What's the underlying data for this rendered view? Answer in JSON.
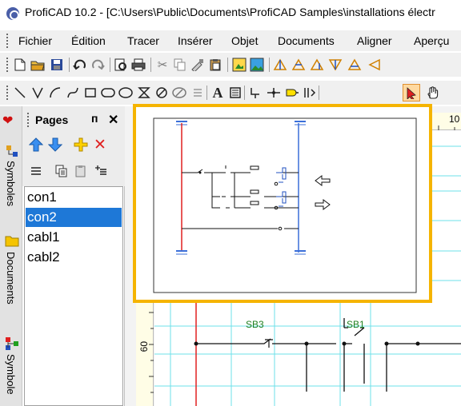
{
  "titlebar": {
    "title": "ProfiCAD 10.2 - [C:\\Users\\Public\\Documents\\ProfiCAD Samples\\installations électr"
  },
  "menubar": {
    "items": [
      "Fichier",
      "Édition",
      "Tracer",
      "Insérer",
      "Objet",
      "Documents",
      "Aligner",
      "Aperçu"
    ]
  },
  "toolbar1": {
    "icons": [
      "new-doc",
      "open-folder",
      "save",
      "undo",
      "redo",
      "print-preview",
      "print",
      "cut",
      "copy",
      "paste-brush",
      "paste",
      "image-tree",
      "image",
      "align-left",
      "align-center-h",
      "align-right",
      "align-top",
      "align-center-v",
      "align-bottom"
    ]
  },
  "toolbar2": {
    "icons": [
      "line",
      "polyline",
      "arc",
      "bezier",
      "rectangle",
      "rounded-rect",
      "ellipse",
      "hourglass",
      "no-entry",
      "eraser-shape",
      "lines",
      "text",
      "text-box",
      "wire",
      "junction",
      "terminal",
      "wire-bundle",
      "select-arrow",
      "pan-hand"
    ]
  },
  "leftstrip": {
    "tabs": [
      "Symboles",
      "Documents",
      "Symbole"
    ]
  },
  "pages": {
    "title": "Pages",
    "pin_glyph": "ᴨ",
    "close_glyph": "✕",
    "items": [
      "con1",
      "con2",
      "cabl1",
      "cabl2"
    ],
    "selected_index": 1
  },
  "ruler": {
    "top_label": "10",
    "left_label": "60"
  },
  "schematic": {
    "components": [
      "SB3",
      "SB1"
    ]
  },
  "colors": {
    "accent": "#1e78d7",
    "overview_border": "#f5b400",
    "wire_red": "#e02020",
    "wire_blue": "#3b6fd9",
    "label_green": "#208020",
    "grid_cyan": "#00c8d8"
  }
}
